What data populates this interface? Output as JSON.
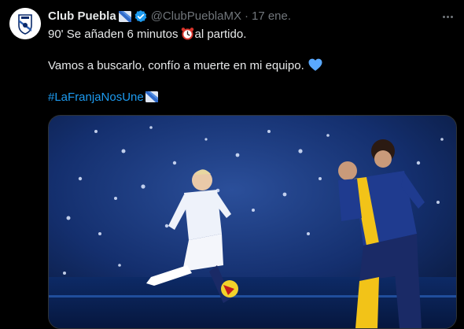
{
  "tweet": {
    "author_name": "Club Puebla",
    "handle": "@ClubPueblaMX",
    "separator": "·",
    "date": "17 ene.",
    "line1": "90' Se añaden 6 minutos",
    "line1_suffix": "al partido.",
    "line2": "Vamos a buscarlo, confío a muerte en mi equipo.",
    "hashtag": "#LaFranjaNosUne"
  },
  "icons": {
    "avatar": "club-puebla-crest",
    "flag": "puebla-franja-flag",
    "verified": "verified-badge",
    "more": "more-options",
    "clock": "alarm-clock-emoji",
    "heart": "blue-heart-emoji"
  },
  "colors": {
    "background": "#000000",
    "text": "#e7e9ea",
    "muted": "#71767b",
    "link": "#1d9bf0",
    "verified": "#1d9bf0",
    "heart": "#5aa9ff"
  },
  "media": {
    "description_hidden": "",
    "player_a_jersey": "",
    "player_b_jersey": ""
  }
}
